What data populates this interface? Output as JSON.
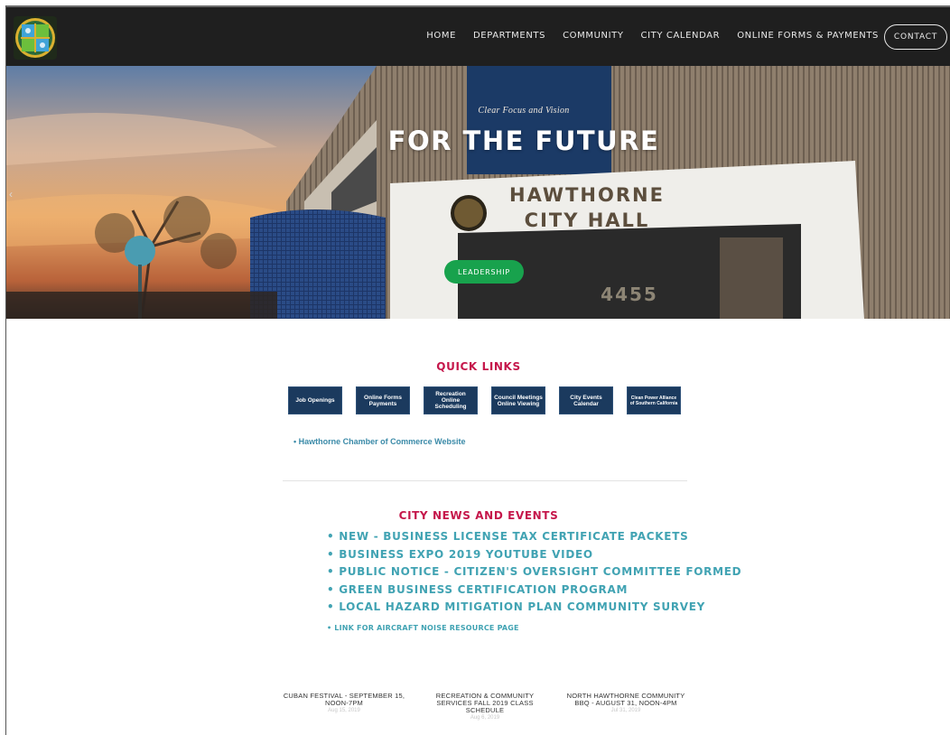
{
  "nav": {
    "items": [
      "HOME",
      "DEPARTMENTS",
      "COMMUNITY",
      "CITY CALENDAR",
      "ONLINE FORMS & PAYMENTS"
    ],
    "contact_label": "CONTACT"
  },
  "hero": {
    "tagline": "Clear Focus and Vision",
    "title": "FOR THE FUTURE",
    "sign_line1": "HAWTHORNE",
    "sign_line2": "CITY HALL",
    "address_number": "4455",
    "button_label": "LEADERSHIP",
    "prev_icon": "chevron-left-icon"
  },
  "quick_links": {
    "title": "QUICK LINKS",
    "tiles": [
      "Job Openings",
      "Online Forms Payments",
      "Recreation Online Scheduling",
      "Council Meetings Online Viewing",
      "City Events Calendar",
      "Clean Power Alliance of Southern California"
    ],
    "chamber_link": "• Hawthorne Chamber of Commerce Website"
  },
  "news": {
    "title": "CITY NEWS AND EVENTS",
    "items": [
      "• NEW - BUSINESS LICENSE TAX CERTIFICATE PACKETS",
      "• BUSINESS EXPO 2019 YOUTUBE VIDEO",
      "• PUBLIC NOTICE - CITIZEN'S OVERSIGHT COMMITTEE FORMED",
      "• GREEN BUSINESS CERTIFICATION PROGRAM",
      "• LOCAL HAZARD MITIGATION PLAN COMMUNITY SURVEY"
    ],
    "small_item": "• LINK FOR AIRCRAFT NOISE RESOURCE PAGE"
  },
  "events": [
    {
      "title": "CUBAN FESTIVAL - SEPTEMBER 15, NOON-7PM",
      "date": "Aug 15, 2019"
    },
    {
      "title": "RECREATION & COMMUNITY SERVICES FALL 2019 CLASS SCHEDULE",
      "date": "Aug 6, 2019"
    },
    {
      "title": "NORTH HAWTHORNE COMMUNITY BBQ - AUGUST 31, NOON-4PM",
      "date": "Jul 31, 2019"
    }
  ],
  "colors": {
    "nav_bg": "#1f1f1f",
    "accent_red": "#c5174b",
    "link_teal": "#41a3b3",
    "tile_navy": "#1b3a5e",
    "button_green": "#18a24d"
  }
}
